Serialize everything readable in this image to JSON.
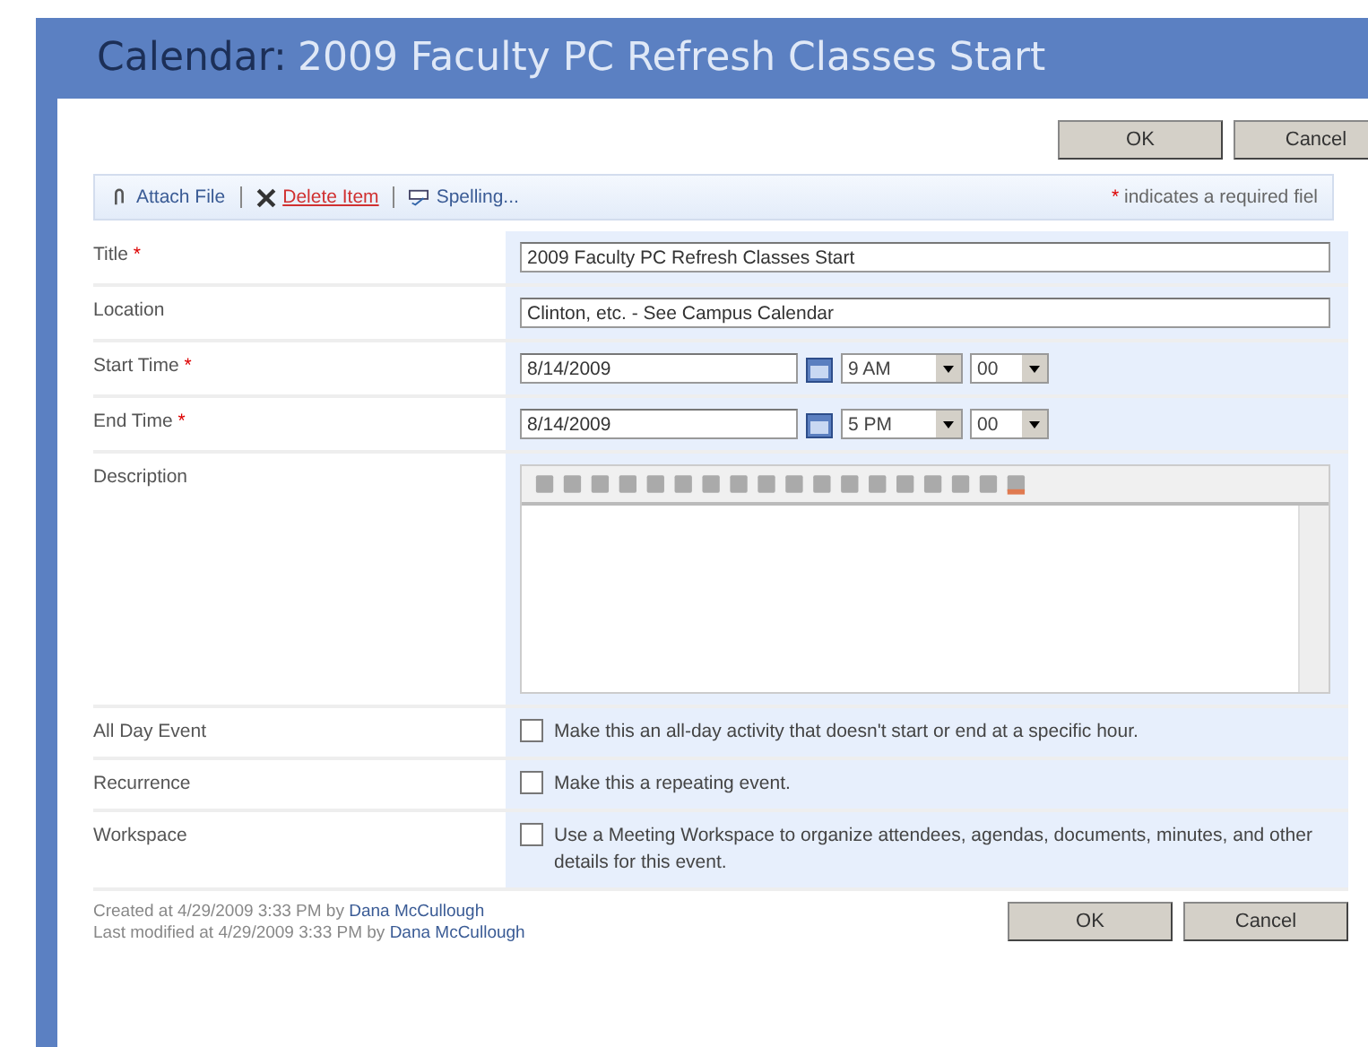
{
  "window": {
    "title_prefix": "Calendar:",
    "title": "2009 Faculty PC Refresh Classes Start"
  },
  "top_buttons": [
    "OK",
    "Cancel"
  ],
  "toolbar": {
    "items": [
      {
        "kind": "attach",
        "label": "Attach File"
      },
      {
        "kind": "delete",
        "label": "Delete Item"
      },
      {
        "kind": "spelling",
        "label": "Spelling..."
      }
    ],
    "required_note": "indicates a required fiel",
    "required_mark": "*"
  },
  "fields": [
    {
      "kind": "text",
      "label": "Title",
      "required": true,
      "value": "2009 Faculty PC Refresh Classes Start"
    },
    {
      "kind": "text",
      "label": "Location",
      "required": false,
      "value": "Clinton, etc. - See Campus Calendar"
    },
    {
      "kind": "datetime",
      "label": "Start Time",
      "required": true,
      "date": "8/14/2009",
      "hour": "9 AM",
      "minute": "00"
    },
    {
      "kind": "datetime",
      "label": "End Time",
      "required": true,
      "date": "8/14/2009",
      "hour": "5 PM",
      "minute": "00"
    },
    {
      "kind": "richtext",
      "label": "Description",
      "required": false
    },
    {
      "kind": "checkbox",
      "label": "All Day Event",
      "required": false,
      "checked": false,
      "text": "Make this an all-day activity that doesn't start or end at a specific hour."
    },
    {
      "kind": "checkbox",
      "label": "Recurrence",
      "required": false,
      "checked": false,
      "text": "Make this a repeating event."
    },
    {
      "kind": "checkbox",
      "label": "Workspace",
      "required": false,
      "checked": false,
      "text": "Use a Meeting Workspace to organize attendees, agendas, documents, minutes, and other details for this event."
    }
  ],
  "footer": {
    "created_prefix": "Created at 4/29/2009 3:33 PM by",
    "created_by": "Dana McCullough",
    "modified_prefix": "Last modified at 4/29/2009 3:33 PM by",
    "modified_by": "Dana McCullough"
  },
  "bottom_buttons": [
    "OK",
    "Cancel"
  ]
}
